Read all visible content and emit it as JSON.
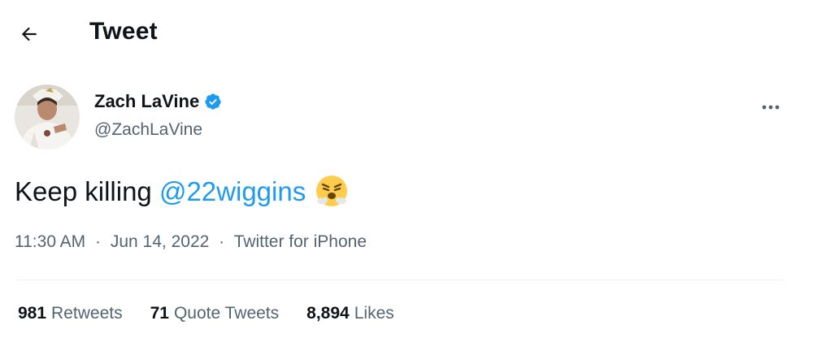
{
  "header": {
    "title": "Tweet",
    "back_icon": "back-arrow-icon"
  },
  "author": {
    "display_name": "Zach LaVine",
    "handle": "@ZachLaVine",
    "verified_icon": "verified-badge-icon",
    "more_icon": "more-dots-icon"
  },
  "tweet": {
    "text_before": "Keep killing ",
    "mention": "@22wiggins",
    "emoji_icon": "face-with-steam-from-nose-emoji"
  },
  "meta": {
    "time": "11:30 AM",
    "separator": "·",
    "date": "Jun 14, 2022",
    "source": "Twitter for iPhone"
  },
  "stats": {
    "retweets_count": "981",
    "retweets_label": "Retweets",
    "quotes_count": "71",
    "quotes_label": "Quote Tweets",
    "likes_count": "8,894",
    "likes_label": "Likes"
  },
  "colors": {
    "text": "#0f1419",
    "secondary": "#536471",
    "accent": "#1d9bf0",
    "divider": "#eff3f4"
  }
}
